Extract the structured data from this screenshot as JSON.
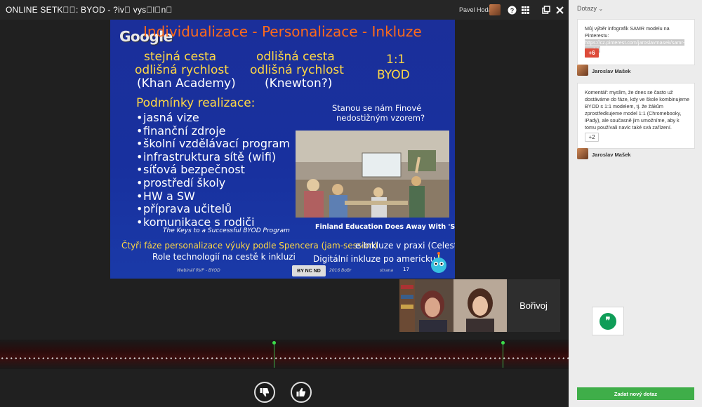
{
  "header": {
    "title": "ONLINE SETK\u0000\u0000: BYOD - ?iv\u0000 vys\u0000l\u0000n\u0000",
    "user_name": "Pavel Hodál"
  },
  "slide": {
    "logo": "Google",
    "title": "Individualizace - Personalizace - Inkluze",
    "col1": [
      "stejná cesta",
      "odlišná rychlost",
      "(Khan Academy)"
    ],
    "col2": [
      "odlišná cesta",
      "odlišná rychlost",
      "(Knewton?)"
    ],
    "col3": [
      "1:1",
      "BYOD"
    ],
    "conditions_title": "Podmínky realizace:",
    "conditions": [
      "jasná vize",
      "finanční zdroje",
      "školní vzdělávací program",
      "infrastruktura sítě (wifi)",
      "síťová bezpečnost",
      "prostředí školy",
      "HW a SW",
      "příprava učitelů",
      "komunikace s rodiči"
    ],
    "keys_caption": "The Keys to a Successful BYOD Program",
    "finland_question": [
      "Stanou se nám Finové",
      "nedostižným vzorem?"
    ],
    "finland_caption": "Finland Education Does Away With 'Subjects'",
    "bottom_left_1": "Čtyři fáze personalizace výuky podle Spencera (jam-session)",
    "bottom_left_2": "Role technologií na cestě k inkluzi",
    "bottom_right_1": "e-Inkluze v praxi (Celest)",
    "bottom_right_2": "Digitální inkluze po americku",
    "footer_left": "Webinář RVP - BYOD",
    "footer_mid": "2016 BoBr",
    "footer_cc": "BY NC ND",
    "footer_strana": "strana",
    "page_number": "17"
  },
  "participants": {
    "name_tile": "Bořivoj"
  },
  "panel": {
    "header": "Dotazy",
    "questions": [
      {
        "text_before": "Můj výběr infografik SAMR modelu na Pinterestu: ",
        "link": "https://cz.pinterest.com/jaroslavmasek/samr-model/",
        "votes": "+6",
        "author": "Jaroslav Mašek"
      },
      {
        "text": "Komentář: myslím, že dnes se často už dostáváme do fáze, kdy ve škole kombinujeme BYOD s 1:1 modelem, tj. že žákům zprostředkujeme model 1:1 (Chromebooky, iPady), ale současně jim umožníme, aby k tomu používali navíc také svá zařízení.",
        "votes": "+2",
        "author": "Jaroslav Mašek"
      }
    ],
    "new_question_button": "Zadat nový dotaz"
  },
  "colors": {
    "accent_green": "#3fae49",
    "vote_red": "#dd4b39",
    "slide_title": "#ff6a1a",
    "slide_yellow": "#ffd845"
  }
}
